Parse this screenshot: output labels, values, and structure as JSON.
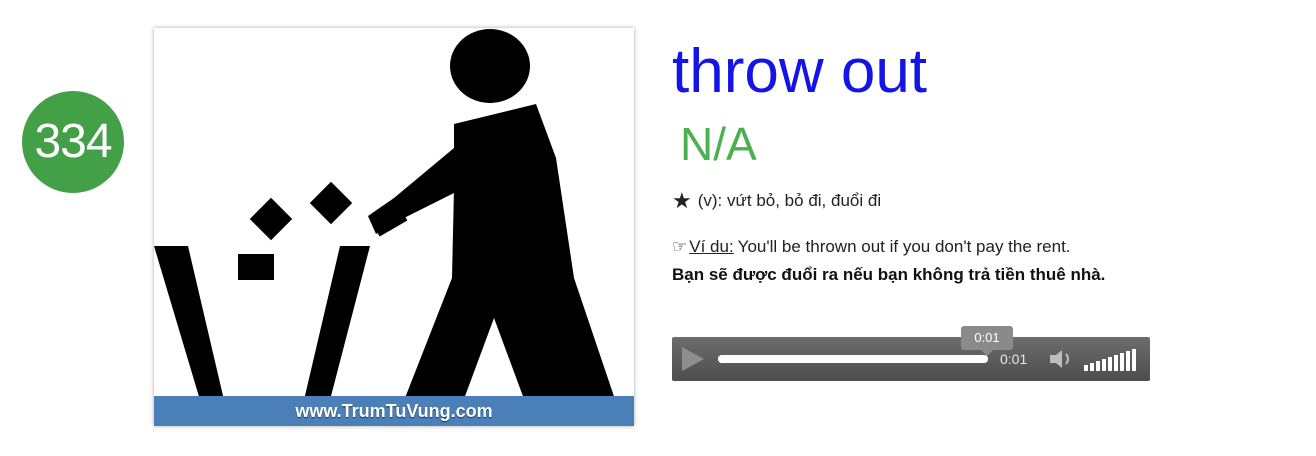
{
  "card": {
    "number": "334",
    "watermark": "www.TrumTuVung.com"
  },
  "entry": {
    "word": "throw out",
    "pronunciation": "N/A",
    "meaning": "(v): vứt bỏ, bỏ đi, đuổi đi",
    "example_label": "Ví du:",
    "example_text": "You'll be thrown out if you don't pay the rent.",
    "translation": "Bạn sẽ được đuổi ra nếu bạn không trả tiền thuê nhà."
  },
  "player": {
    "current_time": "0:01",
    "tooltip_time": "0:01",
    "progress_fraction": 1.0,
    "volume_fraction": 1.0
  },
  "colors": {
    "badge": "#43a047",
    "word": "#1414e6",
    "pronunciation": "#4caf50",
    "watermark_bar": "#4a7fb8"
  },
  "icons": {
    "meaning": "star-icon",
    "example": "pointing-hand-icon",
    "play": "play-icon",
    "volume": "speaker-icon"
  }
}
